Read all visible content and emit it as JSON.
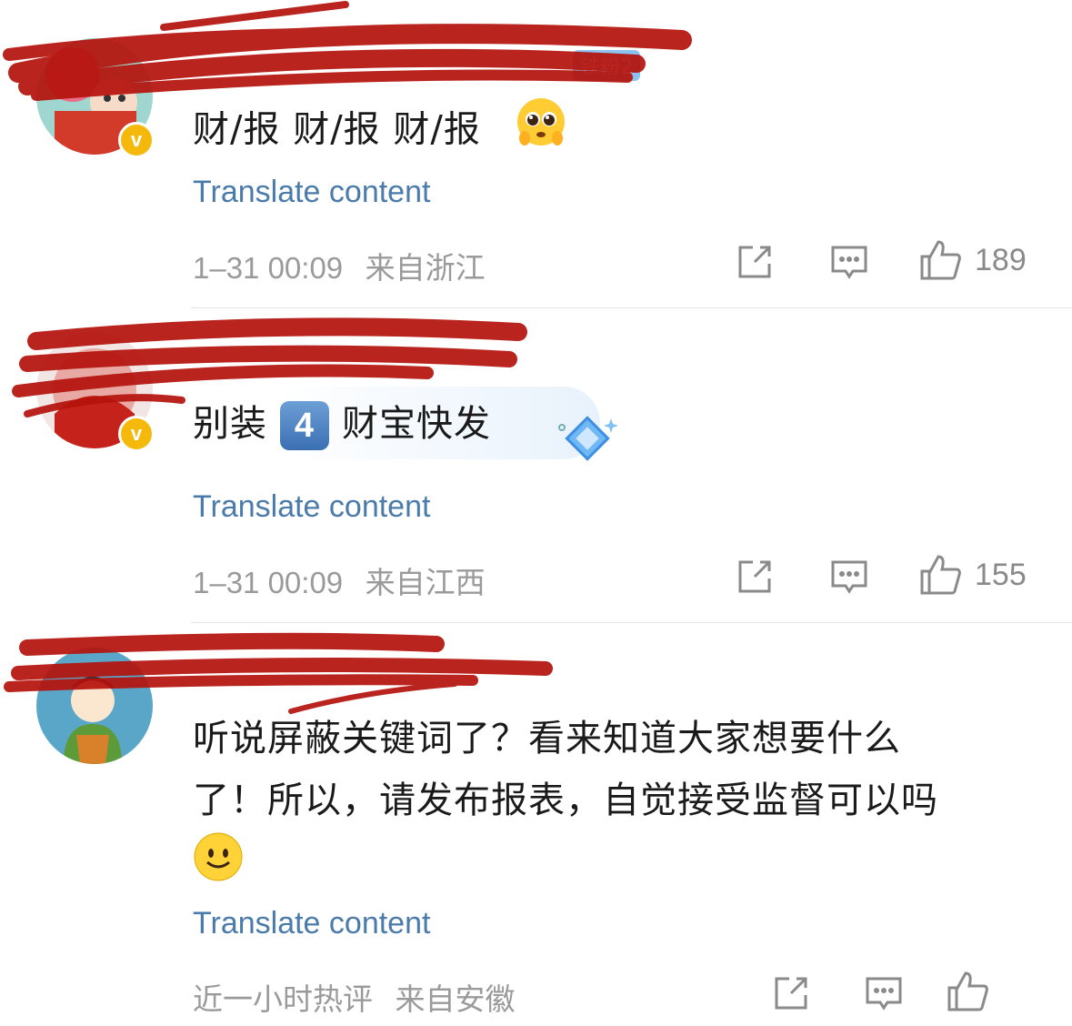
{
  "comments": [
    {
      "text": "财/报 财/报  财/报",
      "fan_badge": "铁粉2",
      "translate": "Translate content",
      "time": "1–31 00:09",
      "location": "来自浙江",
      "likes": "189",
      "verified": "v"
    },
    {
      "text_a": "别装",
      "keycap": "4",
      "text_b": "财宝快发",
      "translate": "Translate content",
      "time": "1–31 00:09",
      "location": "来自江西",
      "likes": "155",
      "verified": "v"
    },
    {
      "line1": "听说屏蔽关键词了？看来知道大家想要什么",
      "line2": "了！所以，请发布报表，自觉接受监督可以吗",
      "translate": "Translate content",
      "time": "近一小时热评",
      "location": "来自安徽"
    }
  ],
  "colors": {
    "link": "#4a7bab",
    "meta": "#9a9a9a",
    "verified": "#f5b90c",
    "redaction": "#b5120c"
  },
  "icons": [
    "share-icon",
    "reply-icon",
    "like-icon"
  ]
}
